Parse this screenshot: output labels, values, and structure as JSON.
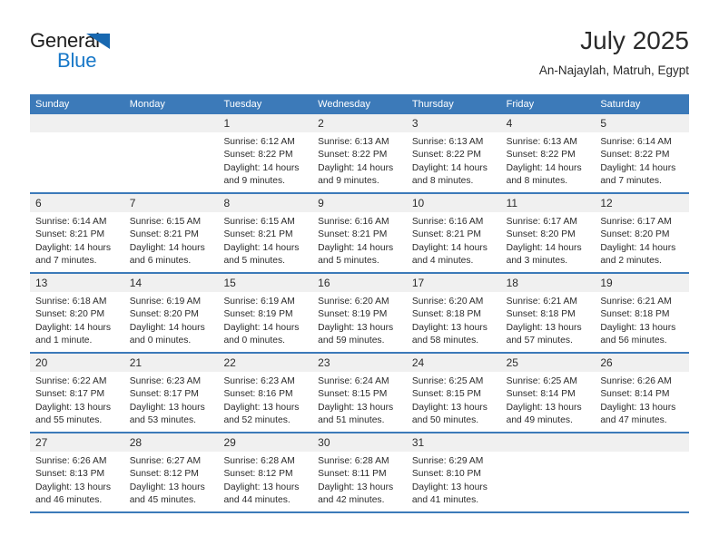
{
  "brand": {
    "word_one": "General",
    "word_two": "Blue",
    "triangle_icon": "triangle-icon",
    "accent_color": "#1878c8"
  },
  "header": {
    "title": "July 2025",
    "subtitle": "An-Najaylah, Matruh, Egypt"
  },
  "theme": {
    "header_blue": "#3c7ab9",
    "cell_head_gray": "#f0f0f0",
    "text": "#2b2b2b"
  },
  "calendar": {
    "weekdays": [
      "Sunday",
      "Monday",
      "Tuesday",
      "Wednesday",
      "Thursday",
      "Friday",
      "Saturday"
    ],
    "weeks": [
      [
        {
          "day": "",
          "sunrise": "",
          "sunset": "",
          "daylight_a": "",
          "daylight_b": ""
        },
        {
          "day": "",
          "sunrise": "",
          "sunset": "",
          "daylight_a": "",
          "daylight_b": ""
        },
        {
          "day": "1",
          "sunrise": "Sunrise: 6:12 AM",
          "sunset": "Sunset: 8:22 PM",
          "daylight_a": "Daylight: 14 hours",
          "daylight_b": "and 9 minutes."
        },
        {
          "day": "2",
          "sunrise": "Sunrise: 6:13 AM",
          "sunset": "Sunset: 8:22 PM",
          "daylight_a": "Daylight: 14 hours",
          "daylight_b": "and 9 minutes."
        },
        {
          "day": "3",
          "sunrise": "Sunrise: 6:13 AM",
          "sunset": "Sunset: 8:22 PM",
          "daylight_a": "Daylight: 14 hours",
          "daylight_b": "and 8 minutes."
        },
        {
          "day": "4",
          "sunrise": "Sunrise: 6:13 AM",
          "sunset": "Sunset: 8:22 PM",
          "daylight_a": "Daylight: 14 hours",
          "daylight_b": "and 8 minutes."
        },
        {
          "day": "5",
          "sunrise": "Sunrise: 6:14 AM",
          "sunset": "Sunset: 8:22 PM",
          "daylight_a": "Daylight: 14 hours",
          "daylight_b": "and 7 minutes."
        }
      ],
      [
        {
          "day": "6",
          "sunrise": "Sunrise: 6:14 AM",
          "sunset": "Sunset: 8:21 PM",
          "daylight_a": "Daylight: 14 hours",
          "daylight_b": "and 7 minutes."
        },
        {
          "day": "7",
          "sunrise": "Sunrise: 6:15 AM",
          "sunset": "Sunset: 8:21 PM",
          "daylight_a": "Daylight: 14 hours",
          "daylight_b": "and 6 minutes."
        },
        {
          "day": "8",
          "sunrise": "Sunrise: 6:15 AM",
          "sunset": "Sunset: 8:21 PM",
          "daylight_a": "Daylight: 14 hours",
          "daylight_b": "and 5 minutes."
        },
        {
          "day": "9",
          "sunrise": "Sunrise: 6:16 AM",
          "sunset": "Sunset: 8:21 PM",
          "daylight_a": "Daylight: 14 hours",
          "daylight_b": "and 5 minutes."
        },
        {
          "day": "10",
          "sunrise": "Sunrise: 6:16 AM",
          "sunset": "Sunset: 8:21 PM",
          "daylight_a": "Daylight: 14 hours",
          "daylight_b": "and 4 minutes."
        },
        {
          "day": "11",
          "sunrise": "Sunrise: 6:17 AM",
          "sunset": "Sunset: 8:20 PM",
          "daylight_a": "Daylight: 14 hours",
          "daylight_b": "and 3 minutes."
        },
        {
          "day": "12",
          "sunrise": "Sunrise: 6:17 AM",
          "sunset": "Sunset: 8:20 PM",
          "daylight_a": "Daylight: 14 hours",
          "daylight_b": "and 2 minutes."
        }
      ],
      [
        {
          "day": "13",
          "sunrise": "Sunrise: 6:18 AM",
          "sunset": "Sunset: 8:20 PM",
          "daylight_a": "Daylight: 14 hours",
          "daylight_b": "and 1 minute."
        },
        {
          "day": "14",
          "sunrise": "Sunrise: 6:19 AM",
          "sunset": "Sunset: 8:20 PM",
          "daylight_a": "Daylight: 14 hours",
          "daylight_b": "and 0 minutes."
        },
        {
          "day": "15",
          "sunrise": "Sunrise: 6:19 AM",
          "sunset": "Sunset: 8:19 PM",
          "daylight_a": "Daylight: 14 hours",
          "daylight_b": "and 0 minutes."
        },
        {
          "day": "16",
          "sunrise": "Sunrise: 6:20 AM",
          "sunset": "Sunset: 8:19 PM",
          "daylight_a": "Daylight: 13 hours",
          "daylight_b": "and 59 minutes."
        },
        {
          "day": "17",
          "sunrise": "Sunrise: 6:20 AM",
          "sunset": "Sunset: 8:18 PM",
          "daylight_a": "Daylight: 13 hours",
          "daylight_b": "and 58 minutes."
        },
        {
          "day": "18",
          "sunrise": "Sunrise: 6:21 AM",
          "sunset": "Sunset: 8:18 PM",
          "daylight_a": "Daylight: 13 hours",
          "daylight_b": "and 57 minutes."
        },
        {
          "day": "19",
          "sunrise": "Sunrise: 6:21 AM",
          "sunset": "Sunset: 8:18 PM",
          "daylight_a": "Daylight: 13 hours",
          "daylight_b": "and 56 minutes."
        }
      ],
      [
        {
          "day": "20",
          "sunrise": "Sunrise: 6:22 AM",
          "sunset": "Sunset: 8:17 PM",
          "daylight_a": "Daylight: 13 hours",
          "daylight_b": "and 55 minutes."
        },
        {
          "day": "21",
          "sunrise": "Sunrise: 6:23 AM",
          "sunset": "Sunset: 8:17 PM",
          "daylight_a": "Daylight: 13 hours",
          "daylight_b": "and 53 minutes."
        },
        {
          "day": "22",
          "sunrise": "Sunrise: 6:23 AM",
          "sunset": "Sunset: 8:16 PM",
          "daylight_a": "Daylight: 13 hours",
          "daylight_b": "and 52 minutes."
        },
        {
          "day": "23",
          "sunrise": "Sunrise: 6:24 AM",
          "sunset": "Sunset: 8:15 PM",
          "daylight_a": "Daylight: 13 hours",
          "daylight_b": "and 51 minutes."
        },
        {
          "day": "24",
          "sunrise": "Sunrise: 6:25 AM",
          "sunset": "Sunset: 8:15 PM",
          "daylight_a": "Daylight: 13 hours",
          "daylight_b": "and 50 minutes."
        },
        {
          "day": "25",
          "sunrise": "Sunrise: 6:25 AM",
          "sunset": "Sunset: 8:14 PM",
          "daylight_a": "Daylight: 13 hours",
          "daylight_b": "and 49 minutes."
        },
        {
          "day": "26",
          "sunrise": "Sunrise: 6:26 AM",
          "sunset": "Sunset: 8:14 PM",
          "daylight_a": "Daylight: 13 hours",
          "daylight_b": "and 47 minutes."
        }
      ],
      [
        {
          "day": "27",
          "sunrise": "Sunrise: 6:26 AM",
          "sunset": "Sunset: 8:13 PM",
          "daylight_a": "Daylight: 13 hours",
          "daylight_b": "and 46 minutes."
        },
        {
          "day": "28",
          "sunrise": "Sunrise: 6:27 AM",
          "sunset": "Sunset: 8:12 PM",
          "daylight_a": "Daylight: 13 hours",
          "daylight_b": "and 45 minutes."
        },
        {
          "day": "29",
          "sunrise": "Sunrise: 6:28 AM",
          "sunset": "Sunset: 8:12 PM",
          "daylight_a": "Daylight: 13 hours",
          "daylight_b": "and 44 minutes."
        },
        {
          "day": "30",
          "sunrise": "Sunrise: 6:28 AM",
          "sunset": "Sunset: 8:11 PM",
          "daylight_a": "Daylight: 13 hours",
          "daylight_b": "and 42 minutes."
        },
        {
          "day": "31",
          "sunrise": "Sunrise: 6:29 AM",
          "sunset": "Sunset: 8:10 PM",
          "daylight_a": "Daylight: 13 hours",
          "daylight_b": "and 41 minutes."
        },
        {
          "day": "",
          "sunrise": "",
          "sunset": "",
          "daylight_a": "",
          "daylight_b": ""
        },
        {
          "day": "",
          "sunrise": "",
          "sunset": "",
          "daylight_a": "",
          "daylight_b": ""
        }
      ]
    ]
  }
}
